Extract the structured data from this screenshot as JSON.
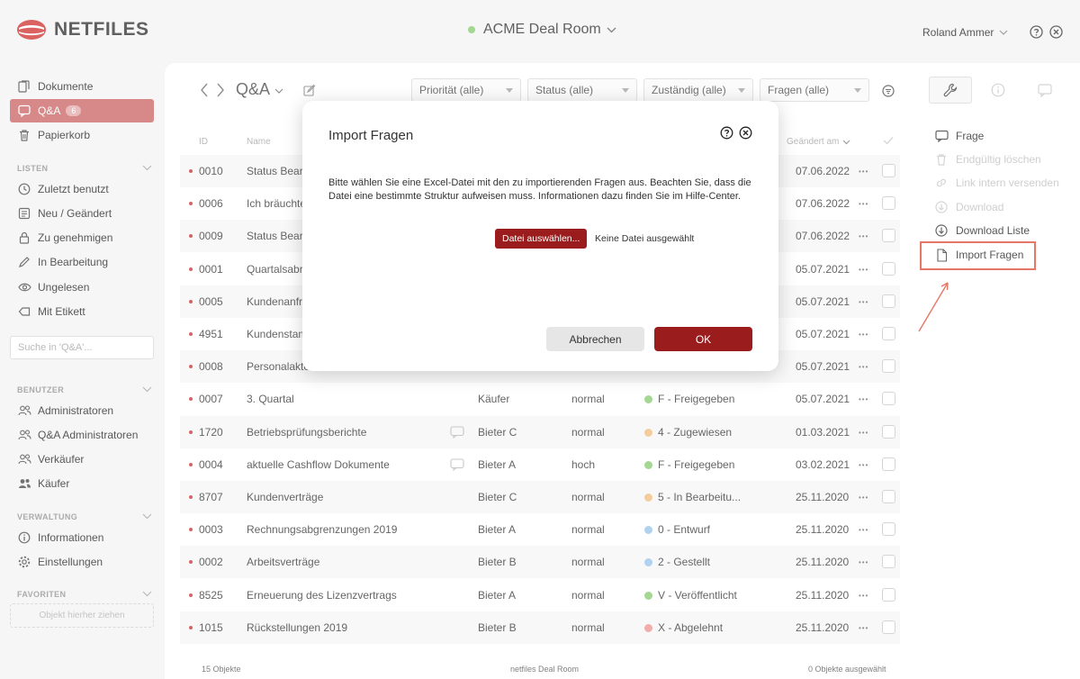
{
  "header": {
    "logo_text": "NETFILES",
    "room_name": "ACME Deal Room",
    "user_name": "Roland Ammer"
  },
  "sidebar": {
    "nav": [
      {
        "label": "Dokumente",
        "icon": "documents-icon"
      },
      {
        "label": "Q&A",
        "icon": "chat-icon",
        "badge": "6",
        "active": true
      },
      {
        "label": "Papierkorb",
        "icon": "trash-icon"
      }
    ],
    "lists_title": "LISTEN",
    "lists": [
      {
        "label": "Zuletzt benutzt",
        "icon": "clock-icon"
      },
      {
        "label": "Neu / Geändert",
        "icon": "list-icon"
      },
      {
        "label": "Zu genehmigen",
        "icon": "lock-icon"
      },
      {
        "label": "In Bearbeitung",
        "icon": "pencil-icon"
      },
      {
        "label": "Ungelesen",
        "icon": "eye-icon"
      },
      {
        "label": "Mit Etikett",
        "icon": "tag-icon"
      }
    ],
    "search_placeholder": "Suche in 'Q&A'...",
    "users_title": "BENUTZER",
    "users": [
      {
        "label": "Administratoren",
        "icon": "users-icon"
      },
      {
        "label": "Q&A Administratoren",
        "icon": "users-icon"
      },
      {
        "label": "Verkäufer",
        "icon": "users-icon"
      },
      {
        "label": "Käufer",
        "icon": "users-filled-icon"
      }
    ],
    "admin_title": "VERWALTUNG",
    "admin": [
      {
        "label": "Informationen",
        "icon": "info-icon"
      },
      {
        "label": "Einstellungen",
        "icon": "gear-icon"
      }
    ],
    "favorites_title": "FAVORITEN",
    "favorites_drop": "Objekt hierher ziehen"
  },
  "main": {
    "title": "Q&A",
    "filters": [
      "Priorität (alle)",
      "Status (alle)",
      "Zuständig (alle)",
      "Fragen (alle)"
    ],
    "columns": {
      "id": "ID",
      "name": "Name",
      "changed": "Geändert am"
    },
    "rows": [
      {
        "id": "0010",
        "name": "Status Bearb",
        "assignee": "",
        "priority": "",
        "status": "",
        "status_color": "",
        "date": "07.06.2022"
      },
      {
        "id": "0006",
        "name": "Ich bräuchte",
        "assignee": "",
        "priority": "",
        "status": "",
        "status_color": "",
        "date": "07.06.2022"
      },
      {
        "id": "0009",
        "name": "Status Bearb",
        "assignee": "",
        "priority": "",
        "status": "",
        "status_color": "",
        "date": "07.06.2022"
      },
      {
        "id": "0001",
        "name": "Quartalsabr",
        "assignee": "",
        "priority": "",
        "status": "",
        "status_color": "",
        "date": "05.07.2021"
      },
      {
        "id": "0005",
        "name": "Kundenanfra",
        "assignee": "",
        "priority": "",
        "status": "",
        "status_color": "",
        "date": "05.07.2021"
      },
      {
        "id": "4951",
        "name": "Kundenstam",
        "assignee": "",
        "priority": "",
        "status": "",
        "status_color": "",
        "date": "05.07.2021"
      },
      {
        "id": "0008",
        "name": "Personalakte",
        "assignee": "",
        "priority": "",
        "status": "",
        "status_color": "",
        "date": "05.07.2021"
      },
      {
        "id": "0007",
        "name": "3. Quartal",
        "assignee": "Käufer",
        "priority": "normal",
        "status": "F - Freigegeben",
        "status_color": "#8fcf7a",
        "date": "05.07.2021"
      },
      {
        "id": "1720",
        "name": "Betriebsprüfungsberichte",
        "assignee": "Bieter C",
        "priority": "normal",
        "status": "4 - Zugewiesen",
        "status_color": "#f2c38a",
        "date": "01.03.2021",
        "comment": true
      },
      {
        "id": "0004",
        "name": "aktuelle Cashflow Dokumente",
        "assignee": "Bieter A",
        "priority": "hoch",
        "status": "F - Freigegeben",
        "status_color": "#8fcf7a",
        "date": "03.02.2021",
        "comment": true
      },
      {
        "id": "8707",
        "name": "Kundenverträge",
        "assignee": "Bieter C",
        "priority": "normal",
        "status": "5 - In Bearbeitu...",
        "status_color": "#f2c38a",
        "date": "25.11.2020"
      },
      {
        "id": "0003",
        "name": "Rechnungsabgrenzungen 2019",
        "assignee": "Bieter A",
        "priority": "normal",
        "status": "0 - Entwurf",
        "status_color": "#9fc8ec",
        "date": "25.11.2020"
      },
      {
        "id": "0002",
        "name": "Arbeitsverträge",
        "assignee": "Bieter B",
        "priority": "normal",
        "status": "2 - Gestellt",
        "status_color": "#9fc8ec",
        "date": "25.11.2020"
      },
      {
        "id": "8525",
        "name": "Erneuerung des Lizenzvertrags",
        "assignee": "Bieter A",
        "priority": "normal",
        "status": "V - Veröffentlicht",
        "status_color": "#8fcf7a",
        "date": "25.11.2020"
      },
      {
        "id": "1015",
        "name": "Rückstellungen 2019",
        "assignee": "Bieter B",
        "priority": "normal",
        "status": "X - Abgelehnt",
        "status_color": "#ef9a9a",
        "date": "25.11.2020"
      }
    ],
    "footer_count": "15 Objekte",
    "footer_center": "netfiles Deal Room",
    "footer_selected": "0 Objekte ausgewählt"
  },
  "right_panel": {
    "actions": [
      {
        "label": "Frage",
        "icon": "speech-bubble-icon",
        "disabled": false
      },
      {
        "label": "Endgültig löschen",
        "icon": "trash-icon",
        "disabled": true
      },
      {
        "label": "Link intern versenden",
        "icon": "link-icon",
        "disabled": true
      },
      {
        "label": "Download",
        "icon": "download-icon",
        "disabled": true
      },
      {
        "label": "Download Liste",
        "icon": "download-icon",
        "disabled": false
      },
      {
        "label": "Import Fragen",
        "icon": "file-icon",
        "disabled": false
      }
    ]
  },
  "dialog": {
    "title": "Import Fragen",
    "text": "Bitte wählen Sie eine Excel-Datei mit den zu importierenden Fragen aus. Beachten Sie, dass die Datei eine bestimmte Struktur aufweisen muss. Informationen dazu finden Sie im Hilfe-Center.",
    "file_button": "Datei auswählen...",
    "no_file": "Keine Datei ausgewählt",
    "cancel": "Abbrechen",
    "ok": "OK"
  },
  "colors": {
    "accent": "#9b1c1c",
    "active_nav": "#cf6e6e",
    "highlight": "#e05a45"
  }
}
